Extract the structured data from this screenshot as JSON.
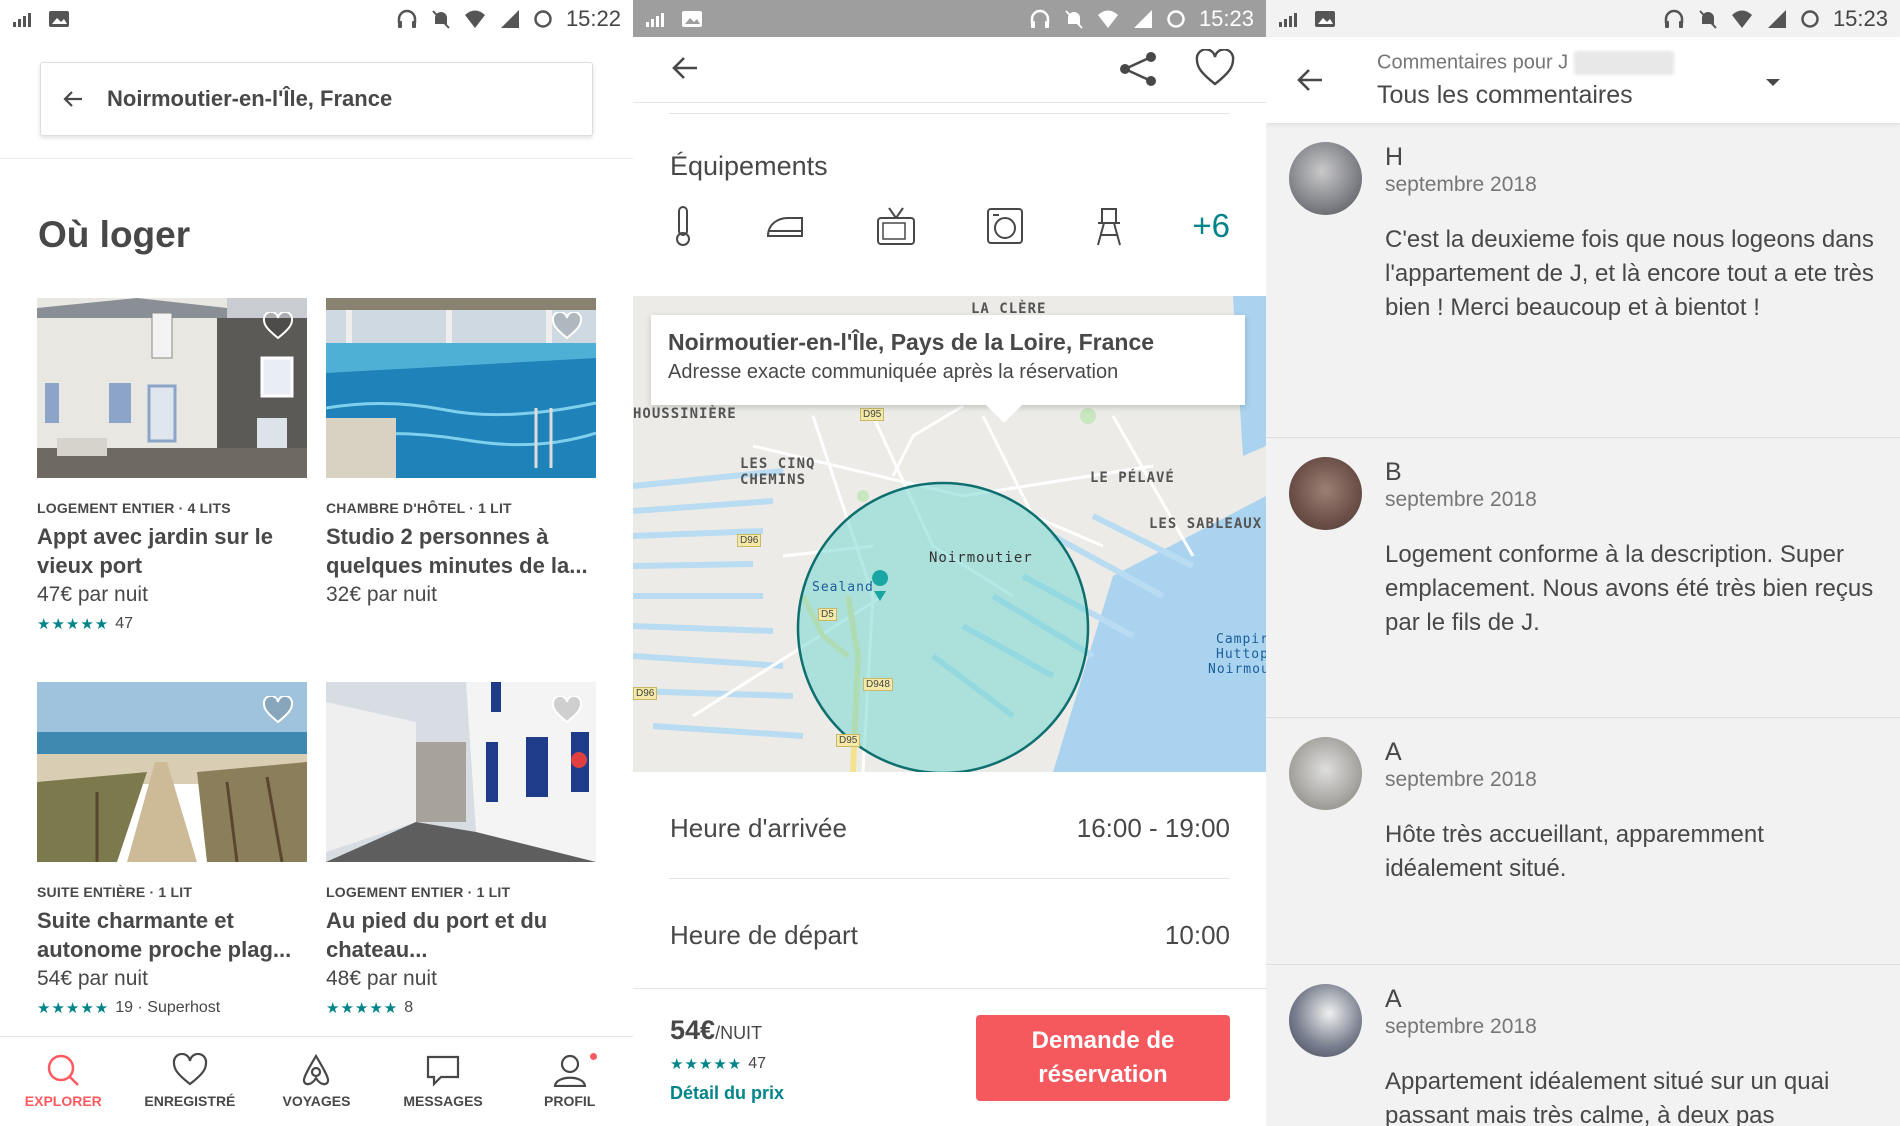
{
  "status_bars": [
    {
      "time": "15:22"
    },
    {
      "time": "15:23"
    },
    {
      "time": "15:23"
    }
  ],
  "search": {
    "location": "Noirmoutier-en-l'Île, France"
  },
  "explore": {
    "section_title": "Où loger",
    "listings": [
      {
        "kind": "LOGEMENT ENTIER · 4 LITS",
        "name": "Appt avec jardin sur le vieux port",
        "price": "47€ par nuit",
        "stars": "★★★★★",
        "rating": "47"
      },
      {
        "kind": "CHAMBRE D'HÔTEL · 1 LIT",
        "name": "Studio 2 personnes à quelques minutes de la...",
        "price": "32€ par nuit",
        "stars": "",
        "rating": ""
      },
      {
        "kind": "SUITE ENTIÈRE · 1 LIT",
        "name": "Suite charmante et autonome proche plag...",
        "price": "54€ par nuit",
        "stars": "★★★★★",
        "rating": "19 · Superhost"
      },
      {
        "kind": "LOGEMENT ENTIER · 1 LIT",
        "name": "Au pied du port et du chateau...",
        "price": "48€ par nuit",
        "stars": "★★★★★",
        "rating": "8"
      }
    ]
  },
  "nav": {
    "items": [
      {
        "label": "EXPLORER",
        "icon": "search-icon",
        "active": true
      },
      {
        "label": "ENREGISTRÉ",
        "icon": "heart-icon",
        "active": false
      },
      {
        "label": "VOYAGES",
        "icon": "airbnb-logo-icon",
        "active": false
      },
      {
        "label": "MESSAGES",
        "icon": "chat-bubble-icon",
        "active": false
      },
      {
        "label": "PROFIL",
        "icon": "user-icon",
        "active": false
      }
    ]
  },
  "details": {
    "equipements_title": "Équipements",
    "equipements_more": "+6",
    "map": {
      "card_title": "Noirmoutier-en-l'Île, Pays de la Loire, France",
      "card_subtitle": "Adresse exacte communiquée après la réservation",
      "labels": [
        "LA CLÈRE",
        "HOUSSINIÈRE",
        "LES CINQ",
        "CHEMINS",
        "LE PÉLAVÉ",
        "LES SABLEAUX",
        "Noirmoutier",
        "Sealand",
        "Campir",
        "Huttop",
        "Noirmou"
      ],
      "roads": [
        "D95",
        "D96",
        "D5",
        "D948",
        "D95",
        "D96"
      ]
    },
    "checkin_label": "Heure d'arrivée",
    "checkin_value": "16:00 - 19:00",
    "checkout_label": "Heure de départ",
    "checkout_value": "10:00",
    "price": "54€",
    "price_unit": "/NUIT",
    "stars": "★★★★★",
    "rating": "47",
    "price_detail": "Détail du prix",
    "book_line1": "Demande de",
    "book_line2": "réservation"
  },
  "reviews": {
    "subtitle": "Commentaires pour J",
    "title": "Tous les commentaires",
    "items": [
      {
        "initial": "H",
        "date": "septembre 2018",
        "text": "C'est la deuxieme fois que nous logeons dans l'appartement de J, et là encore tout a ete très bien ! Merci beaucoup et à bientot !"
      },
      {
        "initial": "B",
        "date": "septembre 2018",
        "text": "Logement conforme à la description. Super emplacement. Nous avons été très bien reçus par le fils de J."
      },
      {
        "initial": "A",
        "date": "septembre 2018",
        "text": "Hôte très accueillant, apparemment idéalement situé."
      },
      {
        "initial": "A",
        "date": "septembre 2018",
        "text": "Appartement idéalement situé sur un quai passant mais très calme, à deux pas"
      }
    ]
  },
  "colors": {
    "accent": "#ff5a5f",
    "teal": "#008489",
    "text": "#484848"
  }
}
